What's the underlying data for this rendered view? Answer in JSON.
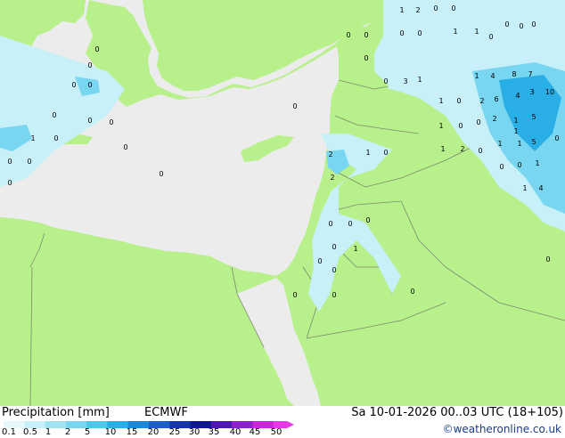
{
  "footer": {
    "title": "Precipitation [mm]",
    "model": "ECMWF",
    "valid": "Sa 10-01-2026 00..03 UTC (18+105)",
    "credit": "©weatheronline.co.uk"
  },
  "legend": {
    "ticks": [
      "0.1",
      "0.5",
      "1",
      "2",
      "5",
      "10",
      "15",
      "20",
      "25",
      "30",
      "35",
      "40",
      "45",
      "50"
    ],
    "colors": [
      "#e6f8fc",
      "#c8f0f8",
      "#a0e4f4",
      "#78d6f0",
      "#4ec6ec",
      "#2aaee6",
      "#1e88d8",
      "#1860c4",
      "#1438a8",
      "#101890",
      "#5018b0",
      "#9020c8",
      "#c828d8",
      "#e838e8"
    ]
  },
  "colors": {
    "sea": "#ececec",
    "land": "#b8f08c",
    "border": "#7a8a70",
    "precip_light": "#c8f0f8",
    "precip_mid": "#78d6f0",
    "precip_heavy": "#2aaee6"
  },
  "precip_labels": [
    {
      "text": "1"
    },
    {
      "text": "2"
    },
    {
      "text": "0"
    },
    {
      "text": "0"
    },
    {
      "text": "0"
    },
    {
      "text": "0"
    },
    {
      "text": "0"
    },
    {
      "text": "0"
    },
    {
      "text": "1"
    },
    {
      "text": "0"
    },
    {
      "text": "1"
    },
    {
      "text": "0"
    },
    {
      "text": "0"
    },
    {
      "text": "0"
    },
    {
      "text": "0"
    },
    {
      "text": "3"
    },
    {
      "text": "1"
    },
    {
      "text": "0"
    },
    {
      "text": "1"
    },
    {
      "text": "4"
    },
    {
      "text": "8"
    },
    {
      "text": "7"
    },
    {
      "text": "6"
    },
    {
      "text": "4"
    },
    {
      "text": "3"
    },
    {
      "text": "10"
    },
    {
      "text": "1"
    },
    {
      "text": "0"
    },
    {
      "text": "2"
    },
    {
      "text": "1"
    },
    {
      "text": "5"
    },
    {
      "text": "1"
    },
    {
      "text": "0"
    },
    {
      "text": "0"
    },
    {
      "text": "2"
    },
    {
      "text": "1"
    },
    {
      "text": "5"
    },
    {
      "text": "0"
    },
    {
      "text": "1"
    },
    {
      "text": "2"
    },
    {
      "text": "0"
    },
    {
      "text": "1"
    },
    {
      "text": "1"
    },
    {
      "text": "4"
    },
    {
      "text": "1"
    },
    {
      "text": "0"
    },
    {
      "text": "1"
    },
    {
      "text": "0"
    },
    {
      "text": "2"
    },
    {
      "text": "1"
    },
    {
      "text": "0"
    },
    {
      "text": "2"
    },
    {
      "text": "0"
    },
    {
      "text": "0"
    },
    {
      "text": "0"
    },
    {
      "text": "1"
    },
    {
      "text": "0"
    },
    {
      "text": "0"
    },
    {
      "text": "0"
    },
    {
      "text": "0"
    },
    {
      "text": "0"
    },
    {
      "text": "0"
    },
    {
      "text": "0"
    },
    {
      "text": "0"
    },
    {
      "text": "0"
    },
    {
      "text": "0"
    },
    {
      "text": "1"
    },
    {
      "text": "0"
    },
    {
      "text": "0"
    },
    {
      "text": "0"
    },
    {
      "text": "0"
    },
    {
      "text": "0"
    },
    {
      "text": "0"
    },
    {
      "text": "0"
    },
    {
      "text": "0"
    },
    {
      "text": "0"
    },
    {
      "text": "0"
    },
    {
      "text": "0"
    }
  ]
}
